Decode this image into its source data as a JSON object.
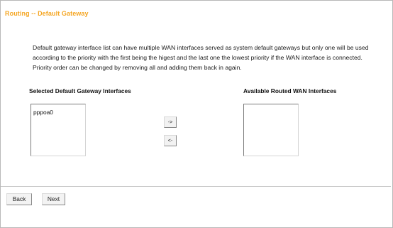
{
  "page": {
    "title": "Routing -- Default Gateway",
    "description": "Default gateway interface list can have multiple WAN interfaces served as system default gateways but only one will be used according to the priority with the first being the higest and the last one the lowest priority if the WAN interface is connected. Priority order can be changed by removing all and adding them back in again."
  },
  "selected": {
    "label": "Selected Default Gateway Interfaces",
    "items": [
      "pppoa0"
    ]
  },
  "available": {
    "label": "Available Routed WAN Interfaces",
    "items": []
  },
  "move": {
    "add_label": "->",
    "remove_label": "<-"
  },
  "footer": {
    "back_label": "Back",
    "next_label": "Next"
  },
  "colors": {
    "title": "#f5a623"
  }
}
